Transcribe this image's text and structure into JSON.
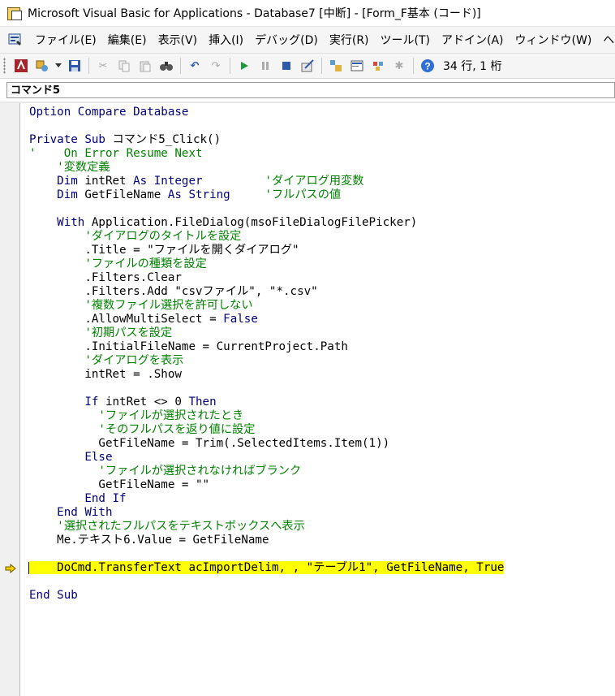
{
  "window": {
    "title": "Microsoft Visual Basic for Applications - Database7 [中断] - [Form_F基本 (コード)]"
  },
  "menu": {
    "items": [
      "ファイル(E)",
      "編集(E)",
      "表示(V)",
      "挿入(I)",
      "デバッグ(D)",
      "実行(R)",
      "ツール(T)",
      "アドイン(A)",
      "ウィンドウ(W)",
      "ヘル"
    ]
  },
  "toolbar": {
    "position_text": "34 行, 1 桁"
  },
  "object_box": {
    "value": "コマンド5"
  },
  "code": {
    "lines": [
      {
        "segments": [
          {
            "t": "Option Compare Database",
            "c": "blue"
          }
        ]
      },
      {
        "segments": []
      },
      {
        "segments": [
          {
            "t": "Private Sub ",
            "c": "blue"
          },
          {
            "t": "コマンド5_Click()",
            "c": "black"
          }
        ]
      },
      {
        "segments": [
          {
            "t": "'    On Error Resume Next",
            "c": "green"
          }
        ]
      },
      {
        "segments": [
          {
            "t": "    '変数定義",
            "c": "green"
          }
        ]
      },
      {
        "segments": [
          {
            "t": "    Dim ",
            "c": "blue"
          },
          {
            "t": "intRet ",
            "c": "black"
          },
          {
            "t": "As Integer",
            "c": "blue"
          },
          {
            "t": "         ",
            "c": "black"
          },
          {
            "t": "'ダイアログ用変数",
            "c": "green"
          }
        ]
      },
      {
        "segments": [
          {
            "t": "    Dim ",
            "c": "blue"
          },
          {
            "t": "GetFileName ",
            "c": "black"
          },
          {
            "t": "As String",
            "c": "blue"
          },
          {
            "t": "     ",
            "c": "black"
          },
          {
            "t": "'フルパスの値",
            "c": "green"
          }
        ]
      },
      {
        "segments": []
      },
      {
        "segments": [
          {
            "t": "    With ",
            "c": "blue"
          },
          {
            "t": "Application.FileDialog(msoFileDialogFilePicker)",
            "c": "black"
          }
        ]
      },
      {
        "segments": [
          {
            "t": "        'ダイアログのタイトルを設定",
            "c": "green"
          }
        ]
      },
      {
        "segments": [
          {
            "t": "        .Title = \"ファイルを開くダイアログ\"",
            "c": "black"
          }
        ]
      },
      {
        "segments": [
          {
            "t": "        'ファイルの種類を設定",
            "c": "green"
          }
        ]
      },
      {
        "segments": [
          {
            "t": "        .Filters.Clear",
            "c": "black"
          }
        ]
      },
      {
        "segments": [
          {
            "t": "        .Filters.Add \"csvファイル\", \"*.csv\"",
            "c": "black"
          }
        ]
      },
      {
        "segments": [
          {
            "t": "        '複数ファイル選択を許可しない",
            "c": "green"
          }
        ]
      },
      {
        "segments": [
          {
            "t": "        .AllowMultiSelect = ",
            "c": "black"
          },
          {
            "t": "False",
            "c": "blue"
          }
        ]
      },
      {
        "segments": [
          {
            "t": "        '初期パスを設定",
            "c": "green"
          }
        ]
      },
      {
        "segments": [
          {
            "t": "        .InitialFileName = CurrentProject.Path",
            "c": "black"
          }
        ]
      },
      {
        "segments": [
          {
            "t": "        'ダイアログを表示",
            "c": "green"
          }
        ]
      },
      {
        "segments": [
          {
            "t": "        intRet = .Show",
            "c": "black"
          }
        ]
      },
      {
        "segments": []
      },
      {
        "segments": [
          {
            "t": "        If ",
            "c": "blue"
          },
          {
            "t": "intRet <> 0 ",
            "c": "black"
          },
          {
            "t": "Then",
            "c": "blue"
          }
        ]
      },
      {
        "segments": [
          {
            "t": "          'ファイルが選択されたとき",
            "c": "green"
          }
        ]
      },
      {
        "segments": [
          {
            "t": "          'そのフルパスを返り値に設定",
            "c": "green"
          }
        ]
      },
      {
        "segments": [
          {
            "t": "          GetFileName = Trim(.SelectedItems.Item(1))",
            "c": "black"
          }
        ]
      },
      {
        "segments": [
          {
            "t": "        Else",
            "c": "blue"
          }
        ]
      },
      {
        "segments": [
          {
            "t": "          'ファイルが選択されなければブランク",
            "c": "green"
          }
        ]
      },
      {
        "segments": [
          {
            "t": "          GetFileName = \"\"",
            "c": "black"
          }
        ]
      },
      {
        "segments": [
          {
            "t": "        End If",
            "c": "blue"
          }
        ]
      },
      {
        "segments": [
          {
            "t": "    End With",
            "c": "blue"
          }
        ]
      },
      {
        "segments": [
          {
            "t": "    '選択されたフルパスをテキストボックスへ表示",
            "c": "green"
          }
        ]
      },
      {
        "segments": [
          {
            "t": "    Me.テキスト6.Value = GetFileName",
            "c": "black"
          }
        ]
      },
      {
        "segments": []
      },
      {
        "segments": [
          {
            "t": "    DoCmd.TransferText acImportDelim, , \"テーブル1\", GetFileName, True",
            "c": "black",
            "hl": true
          }
        ],
        "current": true
      },
      {
        "segments": []
      },
      {
        "segments": [
          {
            "t": "End Sub",
            "c": "blue"
          }
        ]
      }
    ]
  },
  "colors": {
    "keyword": "#00007a",
    "comment": "#008000",
    "highlight": "#ffff00",
    "arrow": "#f5d000"
  }
}
